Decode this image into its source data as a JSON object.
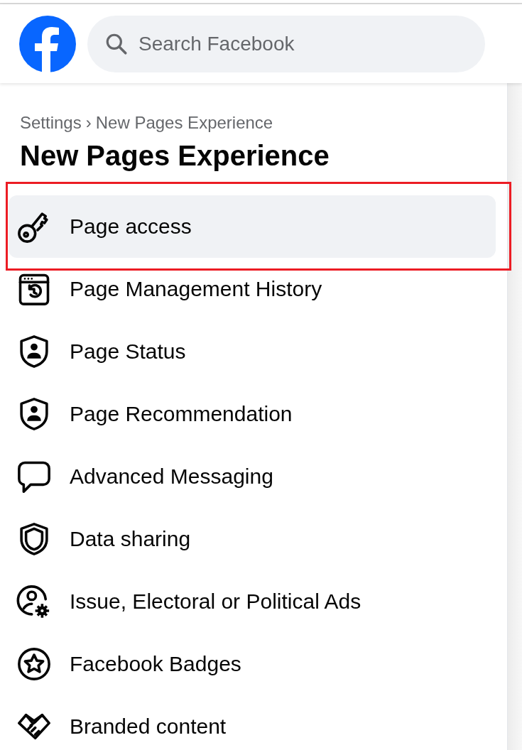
{
  "header": {
    "search": {
      "placeholder": "Search Facebook"
    }
  },
  "breadcrumb": {
    "items": [
      "Settings",
      "New Pages Experience"
    ],
    "separator": "›"
  },
  "title": "New Pages Experience",
  "menu": [
    {
      "label": "Page access",
      "selected": true,
      "highlighted": true
    },
    {
      "label": "Page Management History",
      "selected": false,
      "highlighted": false
    },
    {
      "label": "Page Status",
      "selected": false,
      "highlighted": false
    },
    {
      "label": "Page Recommendation",
      "selected": false,
      "highlighted": false
    },
    {
      "label": "Advanced Messaging",
      "selected": false,
      "highlighted": false
    },
    {
      "label": "Data sharing",
      "selected": false,
      "highlighted": false
    },
    {
      "label": "Issue, Electoral or Political Ads",
      "selected": false,
      "highlighted": false
    },
    {
      "label": "Facebook Badges",
      "selected": false,
      "highlighted": false
    },
    {
      "label": "Branded content",
      "selected": false,
      "highlighted": false
    }
  ]
}
